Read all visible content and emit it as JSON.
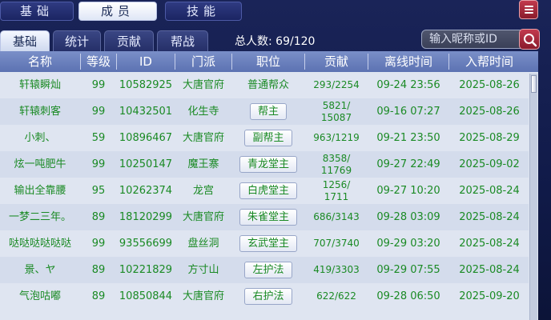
{
  "main_tabs": [
    {
      "label": "基础"
    },
    {
      "label": "成员"
    },
    {
      "label": "技能"
    }
  ],
  "sub_tabs": [
    {
      "label": "基础"
    },
    {
      "label": "统计"
    },
    {
      "label": "贡献"
    },
    {
      "label": "帮战"
    }
  ],
  "total": {
    "label": "总人数:",
    "value": "69/120"
  },
  "search": {
    "placeholder": "输入昵称或ID"
  },
  "table": {
    "headers": [
      "名称",
      "等级",
      "ID",
      "门派",
      "职位",
      "贡献",
      "离线时间",
      "入帮时间"
    ],
    "rows": [
      {
        "name": "轩辕瞬灿",
        "level": "99",
        "id": "10582925",
        "sect": "大唐官府",
        "role": "普通帮众",
        "contrib1": "293/2254",
        "contrib2": "",
        "offline": "09-24 23:56",
        "joined": "2025-08-26"
      },
      {
        "name": "轩辕刺客",
        "level": "99",
        "id": "10432501",
        "sect": "化生寺",
        "role": "帮主",
        "contrib1": "5821/",
        "contrib2": "15087",
        "offline": "09-16 07:27",
        "joined": "2025-08-26"
      },
      {
        "name": "小刺、",
        "level": "59",
        "id": "10896467",
        "sect": "大唐官府",
        "role": "副帮主",
        "contrib1": "963/1219",
        "contrib2": "",
        "offline": "09-21 23:50",
        "joined": "2025-08-29"
      },
      {
        "name": "炫一吨肥牛",
        "level": "99",
        "id": "10250147",
        "sect": "魔王寨",
        "role": "青龙堂主",
        "contrib1": "8358/",
        "contrib2": "11769",
        "offline": "09-27 22:49",
        "joined": "2025-09-02"
      },
      {
        "name": "输出全靠腰",
        "level": "95",
        "id": "10262374",
        "sect": "龙宫",
        "role": "白虎堂主",
        "contrib1": "1256/",
        "contrib2": "1711",
        "offline": "09-27 10:20",
        "joined": "2025-08-24"
      },
      {
        "name": "一梦二三年。",
        "level": "89",
        "id": "18120299",
        "sect": "大唐官府",
        "role": "朱雀堂主",
        "contrib1": "686/3143",
        "contrib2": "",
        "offline": "09-28 03:09",
        "joined": "2025-08-24"
      },
      {
        "name": "哒哒哒哒哒哒",
        "level": "99",
        "id": "93556699",
        "sect": "盘丝洞",
        "role": "玄武堂主",
        "contrib1": "707/3740",
        "contrib2": "",
        "offline": "09-29 03:20",
        "joined": "2025-08-24"
      },
      {
        "name": "景、ヤ",
        "level": "89",
        "id": "10221829",
        "sect": "方寸山",
        "role": "左护法",
        "contrib1": "419/3303",
        "contrib2": "",
        "offline": "09-29 07:55",
        "joined": "2025-08-24"
      },
      {
        "name": "气泡咕嘟",
        "level": "89",
        "id": "10850844",
        "sect": "大唐官府",
        "role": "右护法",
        "contrib1": "622/622",
        "contrib2": "",
        "offline": "09-28 06:50",
        "joined": "2025-09-20"
      }
    ]
  },
  "colors": {
    "member_text": "#1a8a24",
    "header_bg": "#6a80bd",
    "accent_red": "#a52a3c"
  },
  "icons": {
    "menu": "menu-icon",
    "search": "search-icon"
  }
}
